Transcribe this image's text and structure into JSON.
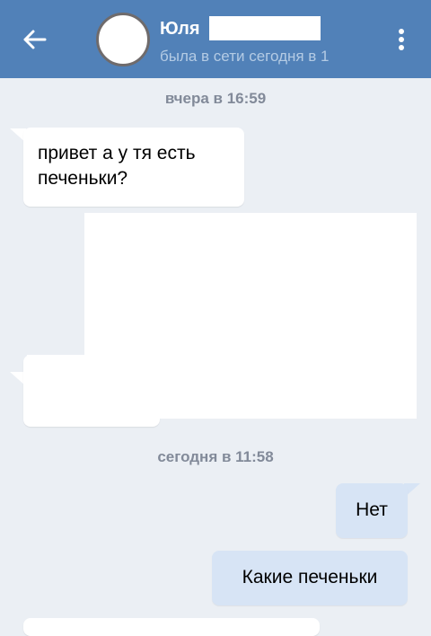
{
  "header": {
    "name": "Юля",
    "status": "была в сети сегодня в 1",
    "back_icon": "arrow-left-icon",
    "menu_icon": "more-vertical-icon"
  },
  "messages": {
    "date_yesterday": "вчера в 16:59",
    "m1": "привет а у тя есть печеньки?",
    "date_today": "сегодня в 11:58",
    "m2": "Нет",
    "m3": "Какие печеньки"
  },
  "colors": {
    "header": "#5181b8",
    "background": "#ebeff4",
    "incoming": "#ffffff",
    "outgoing": "#d7e4f5"
  }
}
